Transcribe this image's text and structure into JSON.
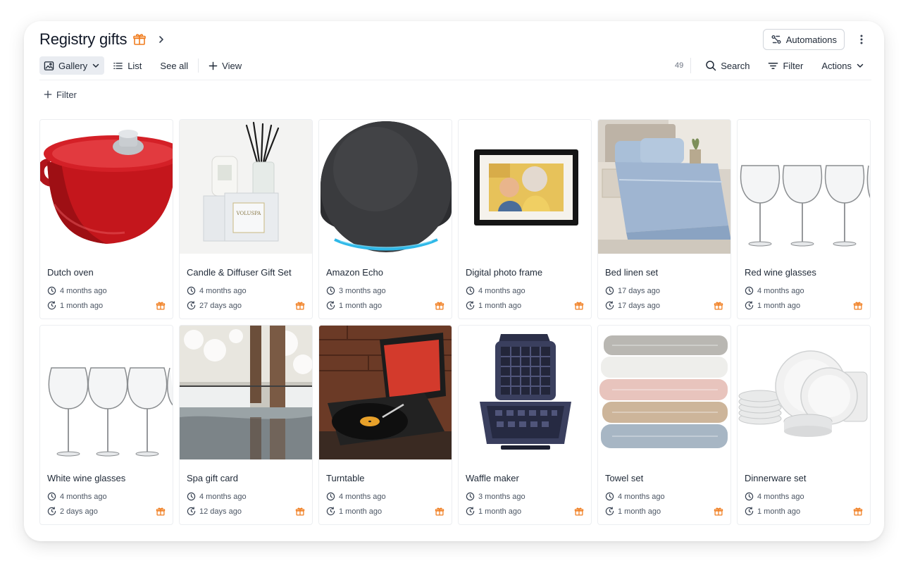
{
  "header": {
    "title": "Registry gifts",
    "automations_label": "Automations"
  },
  "toolbar": {
    "gallery_label": "Gallery",
    "list_label": "List",
    "see_all_label": "See all",
    "view_label": "View",
    "count": "49",
    "search_label": "Search",
    "filter_label": "Filter",
    "actions_label": "Actions"
  },
  "filter_row": {
    "label": "Filter"
  },
  "colors": {
    "accent_orange": "#f07d1f",
    "border": "#eceef1"
  },
  "items": [
    {
      "name": "Dutch oven",
      "created": "4 months ago",
      "updated": "1 month ago"
    },
    {
      "name": "Candle & Diffuser Gift Set",
      "created": "4 months ago",
      "updated": "27 days ago"
    },
    {
      "name": "Amazon Echo",
      "created": "3 months ago",
      "updated": "1 month ago"
    },
    {
      "name": "Digital photo frame",
      "created": "4 months ago",
      "updated": "1 month ago"
    },
    {
      "name": "Bed linen set",
      "created": "17 days ago",
      "updated": "17 days ago"
    },
    {
      "name": "Red wine glasses",
      "created": "4 months ago",
      "updated": "1 month ago"
    },
    {
      "name": "White wine glasses",
      "created": "4 months ago",
      "updated": "2 days ago"
    },
    {
      "name": "Spa gift card",
      "created": "4 months ago",
      "updated": "12 days ago"
    },
    {
      "name": "Turntable",
      "created": "4 months ago",
      "updated": "1 month ago"
    },
    {
      "name": "Waffle maker",
      "created": "3 months ago",
      "updated": "1 month ago"
    },
    {
      "name": "Towel set",
      "created": "4 months ago",
      "updated": "1 month ago"
    },
    {
      "name": "Dinnerware set",
      "created": "4 months ago",
      "updated": "1 month ago"
    }
  ]
}
